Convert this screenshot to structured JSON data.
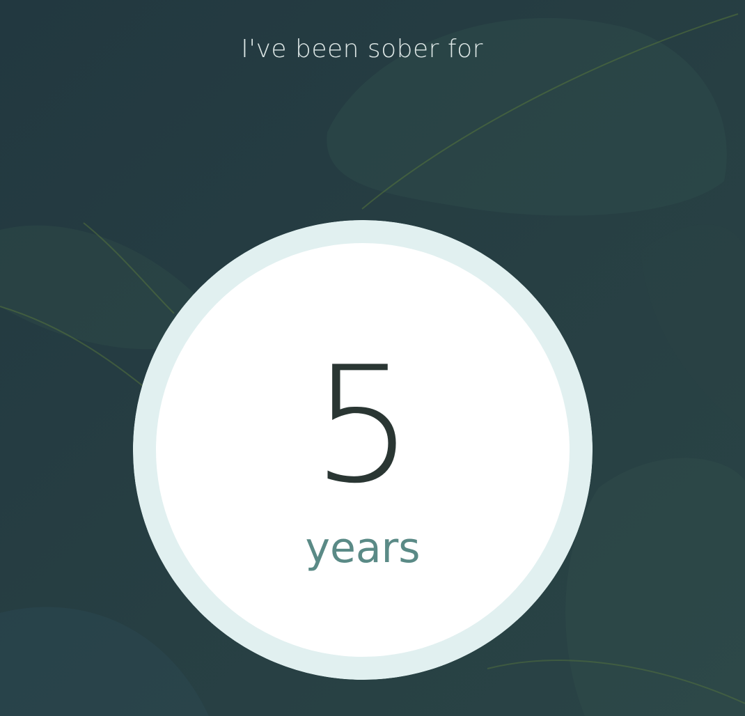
{
  "header": {
    "text": "I've been sober for"
  },
  "counter": {
    "value": "5",
    "unit": "years",
    "progress": 1.0
  },
  "colors": {
    "background": "#243a40",
    "ring_track": "#e1f0f0",
    "ring_fill": "#e1f0f0",
    "disc": "#ffffff",
    "value_text": "#2a3633",
    "unit_text": "#5a8a86",
    "header_text": "#dde7e6"
  }
}
